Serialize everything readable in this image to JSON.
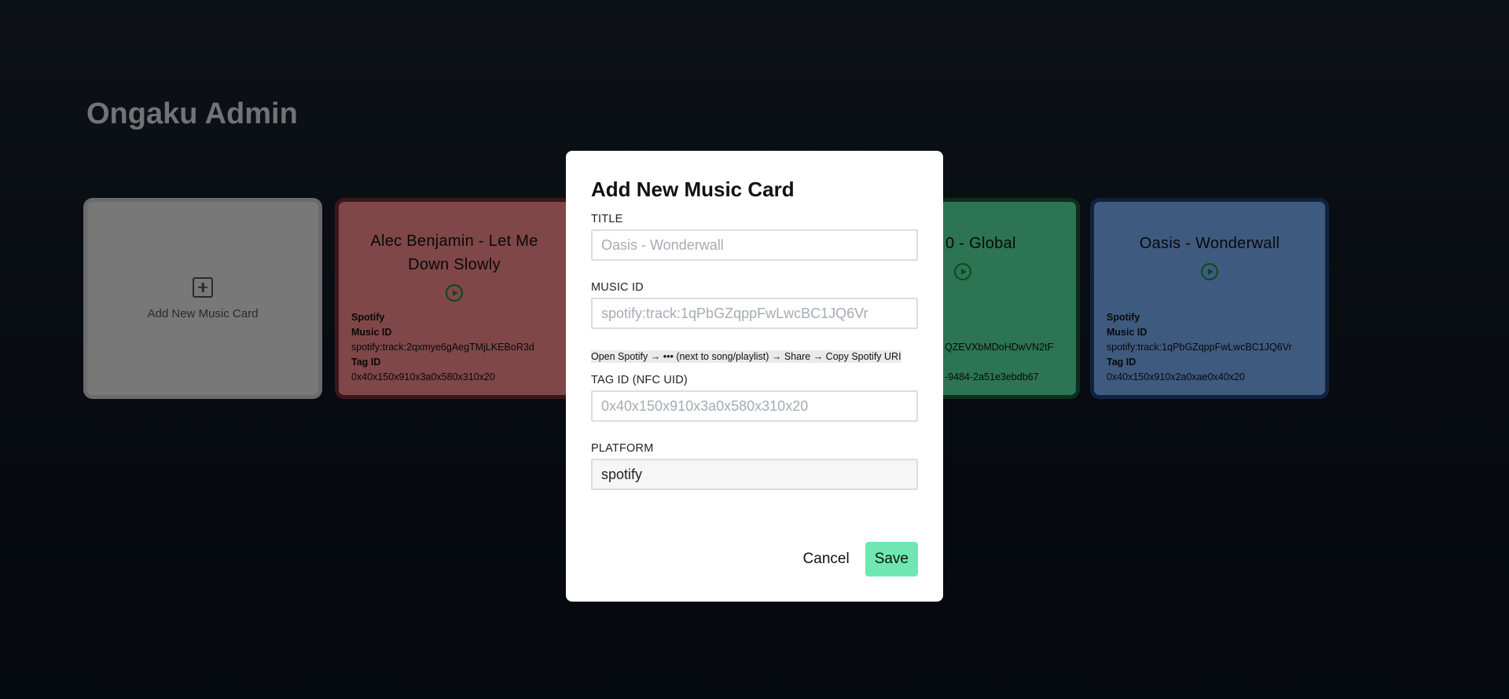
{
  "app": {
    "title": "Ongaku Admin"
  },
  "add_card": {
    "label": "Add New Music Card"
  },
  "cards": [
    {
      "title": "Alec Benjamin - Let Me Down Slowly",
      "platform": "Spotify",
      "music_id_label": "Music ID",
      "music_id": "spotify:track:2qxmye6gAegTMjLKEBoR3d",
      "tag_id_label": "Tag ID",
      "tag_id": "0x40x150x910x3a0x580x310x20",
      "color": "#ff8e8e"
    },
    {
      "title": "0 - Global",
      "music_id": "QZEVXbMDoHDwVN2tF",
      "tag_id": "-9484-2a51e3ebdb67",
      "color": "#58e8a7"
    },
    {
      "title": "Oasis - Wonderwall",
      "platform": "Spotify",
      "music_id_label": "Music ID",
      "music_id": "spotify:track:1qPbGZqppFwLwcBC1JQ6Vr",
      "tag_id_label": "Tag ID",
      "tag_id": "0x40x150x910x2a0xae0x40x20",
      "color": "#7fb4ff"
    }
  ],
  "modal": {
    "title": "Add New Music Card",
    "fields": {
      "title": {
        "label": "TITLE",
        "placeholder": "Oasis - Wonderwall",
        "value": ""
      },
      "music_id": {
        "label": "MUSIC ID",
        "placeholder": "spotify:track:1qPbGZqppFwLwcBC1JQ6Vr",
        "value": "",
        "hint": "Open Spotify → ••• (next to song/playlist) → Share → Copy Spotify URI"
      },
      "tag_id": {
        "label": "TAG ID (NFC UID)",
        "placeholder": "0x40x150x910x3a0x580x310x20",
        "value": ""
      },
      "platform": {
        "label": "PLATFORM",
        "value": "spotify"
      }
    },
    "buttons": {
      "cancel": "Cancel",
      "save": "Save"
    }
  }
}
